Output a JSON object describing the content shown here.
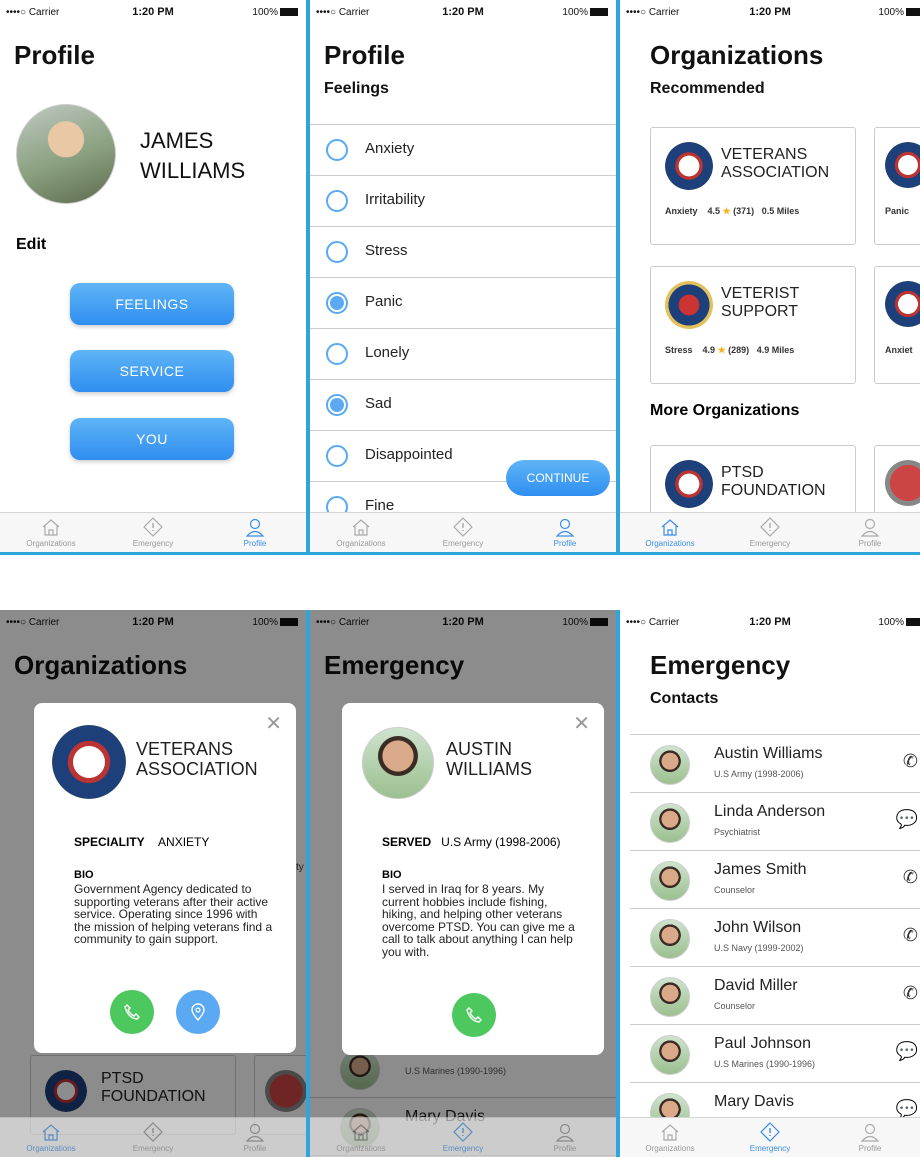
{
  "status": {
    "carrier": "••••○ Carrier",
    "time": "1:20 PM",
    "battery": "100%"
  },
  "tabs": [
    {
      "label": "Organizations",
      "icon": "home-icon"
    },
    {
      "label": "Emergency",
      "icon": "alert-icon"
    },
    {
      "label": "Profile",
      "icon": "user-icon"
    }
  ],
  "profile": {
    "title": "Profile",
    "name_line1": "JAMES",
    "name_line2": "WILLIAMS",
    "edit": "Edit",
    "buttons": [
      "FEELINGS",
      "SERVICE",
      "YOU"
    ]
  },
  "feelings": {
    "title": "Profile",
    "subtitle": "Feelings",
    "items": [
      {
        "label": "Anxiety",
        "checked": false
      },
      {
        "label": "Irritability",
        "checked": false
      },
      {
        "label": "Stress",
        "checked": false
      },
      {
        "label": "Panic",
        "checked": true
      },
      {
        "label": "Lonely",
        "checked": false
      },
      {
        "label": "Sad",
        "checked": true
      },
      {
        "label": "Disappointed",
        "checked": false
      },
      {
        "label": "Fine",
        "checked": false
      }
    ],
    "continue": "CONTINUE"
  },
  "orgs": {
    "title": "Organizations",
    "recommended": "Recommended",
    "more": "More Organizations",
    "cards": [
      {
        "name1": "VETERANS",
        "name2": "ASSOCIATION",
        "tag": "Anxiety",
        "rating": "4.5",
        "reviews": "(371)",
        "distance": "0.5 Miles"
      },
      {
        "name1": "VETERIST",
        "name2": "SUPPORT",
        "tag": "Stress",
        "rating": "4.9",
        "reviews": "(289)",
        "distance": "4.9 Miles"
      },
      {
        "name1": "PTSD",
        "name2": "FOUNDATION"
      }
    ],
    "side_tags": [
      "Panic",
      "Anxiet"
    ]
  },
  "org_modal": {
    "name1": "VETERANS",
    "name2": "ASSOCIATION",
    "spec_label": "SPECIALITY",
    "spec_value": "ANXIETY",
    "bio_label": "BIO",
    "bio": "Government Agency dedicated to supporting veterans after their active service. Operating since 1996 with the mission of helping veterans find a community to gain support.",
    "bg_card_name1": "PTSD",
    "bg_card_name2": "FOUNDATION",
    "bg_side": "ty"
  },
  "emergency": {
    "title": "Emergency",
    "contacts": "Contacts",
    "list": [
      {
        "name": "Austin Williams",
        "sub": "U.S Army (1998-2006)",
        "icon": "phone-icon"
      },
      {
        "name": "Linda Anderson",
        "sub": "Psychiatrist",
        "icon": "chat-icon"
      },
      {
        "name": "James Smith",
        "sub": "Counselor",
        "icon": "phone-icon"
      },
      {
        "name": "John Wilson",
        "sub": "U.S Navy (1999-2002)",
        "icon": "phone-icon"
      },
      {
        "name": "David Miller",
        "sub": "Counselor",
        "icon": "phone-icon"
      },
      {
        "name": "Paul Johnson",
        "sub": "U.S Marines (1990-1996)",
        "icon": "chat-icon"
      },
      {
        "name": "Mary Davis",
        "sub": "",
        "icon": "chat-icon"
      }
    ]
  },
  "person_modal": {
    "name1": "AUSTIN",
    "name2": "WILLIAMS",
    "served_label": "SERVED",
    "served_value": "U.S Army (1998-2006)",
    "bio_label": "BIO",
    "bio": "I served in Iraq for 8 years. My current hobbies include fishing, hiking, and helping other veterans overcome PTSD. You can give me a call to talk about anything I can help you with."
  }
}
